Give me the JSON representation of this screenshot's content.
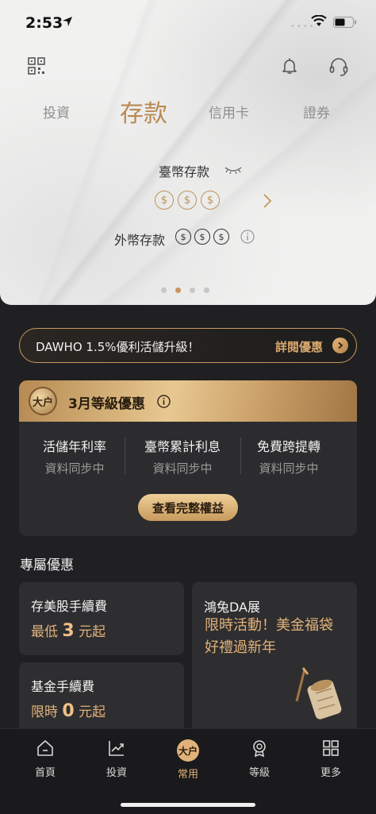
{
  "status_bar": {
    "time": "2:53"
  },
  "header_icons": [
    "qr-code-icon",
    "bell-icon",
    "headset-icon"
  ],
  "tabs": [
    {
      "label": "投資",
      "active": false
    },
    {
      "label": "存款",
      "active": true
    },
    {
      "label": "信用卡",
      "active": false
    },
    {
      "label": "證券",
      "active": false
    }
  ],
  "deposit": {
    "twd_label": "臺幣存款",
    "fx_label": "外幣存款",
    "currency_symbol": "$"
  },
  "pager": {
    "count": 4,
    "active_index": 1
  },
  "banner": {
    "text": "DAWHO 1.5%優利活儲升級！",
    "link": "詳閱優惠"
  },
  "level": {
    "title": "3月等級優惠",
    "medal_text": "大户",
    "stats": [
      {
        "label": "活儲年利率",
        "value": "資料同步中"
      },
      {
        "label": "臺幣累計利息",
        "value": "資料同步中"
      },
      {
        "label": "免費跨提轉",
        "value": "資料同步中"
      }
    ],
    "button": "查看完整權益"
  },
  "promos": {
    "section_title": "專屬優惠",
    "stock_fee": {
      "title": "存美股手續費",
      "prefix": "最低",
      "num": "3",
      "suffix": "元起"
    },
    "fund_fee": {
      "title": "基金手續費",
      "prefix": "限時",
      "num": "0",
      "suffix": "元起"
    },
    "event": {
      "title": "鴻兔DA展",
      "line1": "限時活動！美金福袋",
      "line2": "好禮過新年"
    }
  },
  "tabbar": [
    {
      "label": "首頁",
      "icon": "home-icon"
    },
    {
      "label": "投資",
      "icon": "chart-icon"
    },
    {
      "label": "常用",
      "icon": "dawho-logo-icon",
      "active": true
    },
    {
      "label": "等級",
      "icon": "badge-icon"
    },
    {
      "label": "更多",
      "icon": "grid-icon"
    }
  ],
  "colors": {
    "accent_gold": "#c7955c",
    "background_dark": "#202022",
    "card_dark": "#2e2e30"
  }
}
